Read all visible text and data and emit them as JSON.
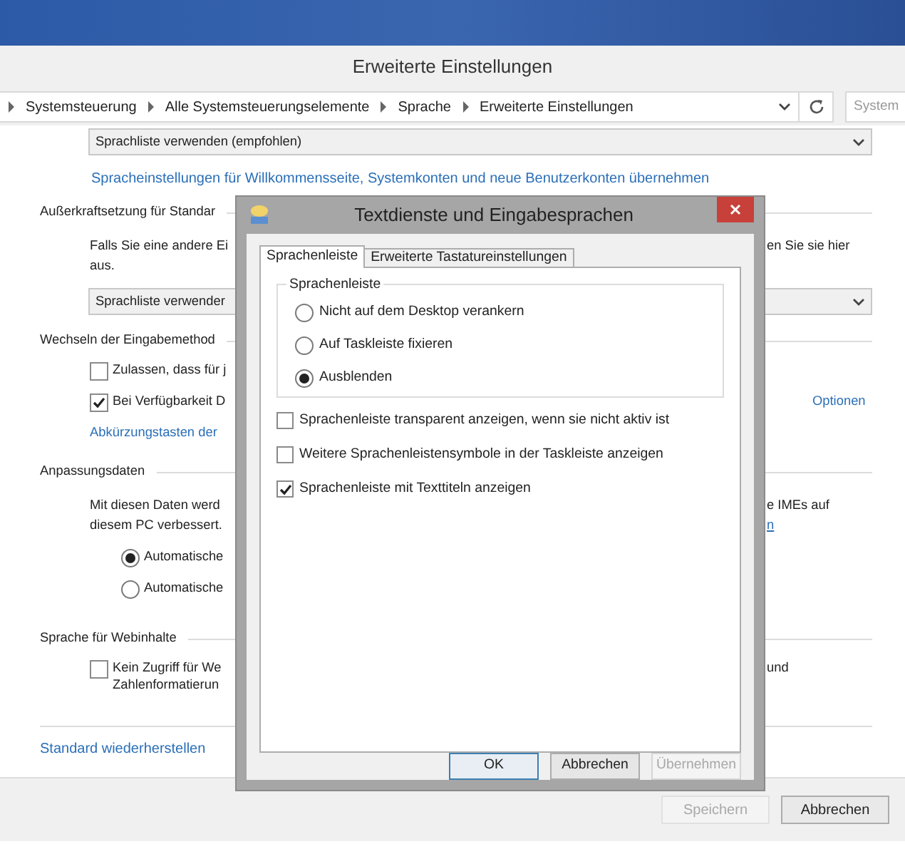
{
  "window": {
    "title": "Erweiterte Einstellungen"
  },
  "address_bar": {
    "crumbs": [
      "Systemsteuerung",
      "Alle Systemsteuerungselemente",
      "Sprache",
      "Erweiterte Einstellungen"
    ]
  },
  "search": {
    "placeholder": "System"
  },
  "top_dropdown": {
    "value": "Sprachliste verwenden (empfohlen)"
  },
  "top_link": "Spracheinstellungen für Willkommensseite, Systemkonten und neue Benutzerkonten übernehmen",
  "sections": [
    {
      "heading": "Außerkraftsetzung für Standar",
      "items": [
        {
          "kind": "text",
          "text": "Falls Sie eine andere Ei",
          "right": "en Sie sie hier"
        },
        {
          "kind": "text",
          "text": "aus."
        },
        {
          "kind": "dropdown",
          "text": "Sprachliste verwender"
        }
      ]
    },
    {
      "heading": "Wechseln der Eingabemethod",
      "items": [
        {
          "kind": "checkbox",
          "text": "Zulassen, dass für j",
          "checked": false
        },
        {
          "kind": "checkbox",
          "text": "Bei Verfügbarkeit D",
          "checked": true,
          "right_link": "Optionen"
        },
        {
          "kind": "link",
          "text": "Abkürzungstasten der"
        }
      ]
    },
    {
      "heading": "Anpassungsdaten",
      "items": [
        {
          "kind": "text",
          "text": "Mit diesen Daten werd",
          "right": "e IMEs auf"
        },
        {
          "kind": "text",
          "text": "diesem PC verbessert.",
          "right_link": "n"
        },
        {
          "kind": "radio",
          "text": "Automatische",
          "selected": true
        },
        {
          "kind": "radio",
          "text": "Automatische",
          "selected": false
        }
      ]
    },
    {
      "heading": "Sprache für Webinhalte",
      "items": [
        {
          "kind": "checkbox",
          "text": "Kein Zugriff für We",
          "checked": false,
          "right": "und",
          "continuation": "Zahlenformatierun"
        }
      ]
    }
  ],
  "restore_link": "Standard wiederherstellen",
  "footer_buttons": [
    {
      "label": "Speichern",
      "disabled": true
    },
    {
      "label": "Abbrechen",
      "disabled": false
    }
  ],
  "dialog": {
    "title": "Textdienste und Eingabesprachen",
    "tabs": [
      {
        "label": "Sprachenleiste",
        "selected": true
      },
      {
        "label": "Erweiterte Tastatureinstellungen",
        "selected": false
      }
    ],
    "group": {
      "title": "Sprachenleiste",
      "options": [
        {
          "label": "Nicht auf dem Desktop verankern",
          "selected": false
        },
        {
          "label": "Auf Taskleiste fixieren",
          "selected": false
        },
        {
          "label": "Ausblenden",
          "selected": true
        }
      ]
    },
    "checkboxes": [
      {
        "label": "Sprachenleiste transparent anzeigen, wenn sie nicht aktiv ist",
        "checked": false
      },
      {
        "label": "Weitere Sprachenleistensymbole in der Taskleiste anzeigen",
        "checked": false
      },
      {
        "label": "Sprachenleiste mit Texttiteln anzeigen",
        "checked": true
      }
    ],
    "buttons": [
      {
        "label": "OK",
        "default": true,
        "disabled": false
      },
      {
        "label": "Abbrechen",
        "default": false,
        "disabled": false
      },
      {
        "label": "Übernehmen",
        "default": false,
        "disabled": true
      }
    ]
  }
}
